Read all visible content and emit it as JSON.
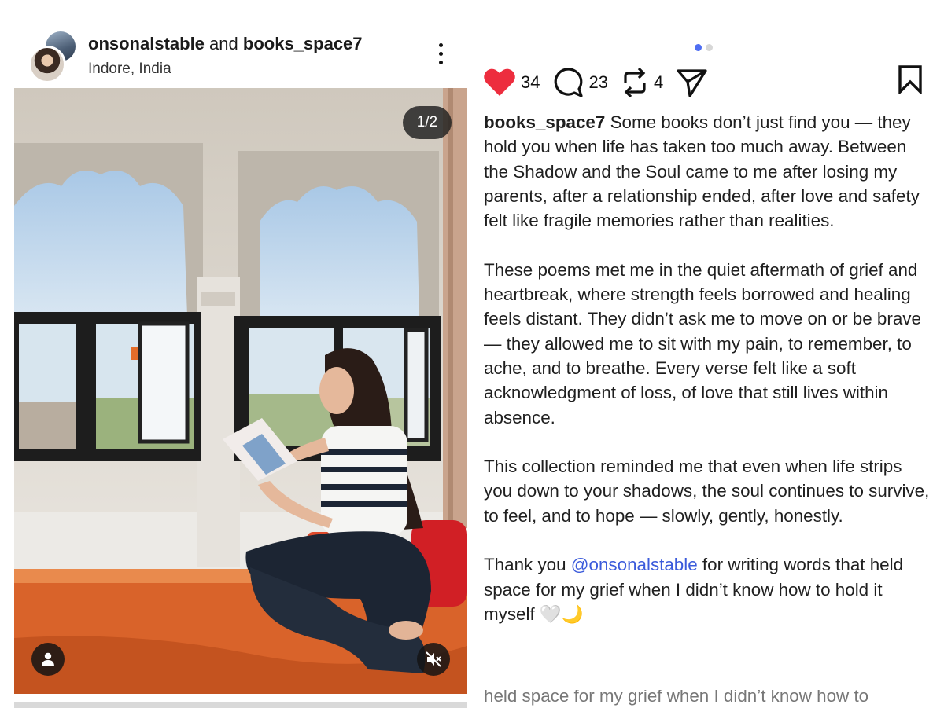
{
  "post": {
    "author_primary": "onsonalstable",
    "connector": "and",
    "author_secondary": "books_space7",
    "location": "Indore, India",
    "more_icon": "more-vertical-icon"
  },
  "media": {
    "pager": "1/2",
    "tag_icon": "user-tag-icon",
    "sound_icon": "mute-icon",
    "carousel_position": 1,
    "carousel_total": 2
  },
  "actions": {
    "likes": "34",
    "comments": "23",
    "reposts": "4",
    "like_color": "#ed2d3e",
    "icons": [
      "heart-icon",
      "comment-icon",
      "repost-icon",
      "share-icon",
      "bookmark-icon"
    ]
  },
  "caption": {
    "username": "books_space7",
    "p1": "Some books don’t just find you — they hold you when life has taken too much away. Between the Shadow and the Soul came to me after losing my parents, after a relationship ended, after love and safety felt like fragile memories rather than realities.",
    "p2": "These poems met me in the quiet aftermath of grief and heartbreak, where strength feels borrowed and healing feels distant. They didn’t ask me to move on or be brave — they allowed me to sit with my pain, to remember, to ache, and to breathe. Every verse felt like a soft acknowledgment of loss, of love that still lives within absence.",
    "p3": "This collection reminded me that even when life strips you down to your shadows, the soul continues to survive, to feel, and to hope — slowly, gently, honestly.",
    "p4_before": "Thank you ",
    "mention": "@onsonalstable",
    "p4_after": " for writing words that held space for my grief when I didn’t know how to hold it myself 🤍🌙",
    "overflow": "held space for my grief when I didn’t know how to",
    "mention_color": "#3b5bdb"
  }
}
